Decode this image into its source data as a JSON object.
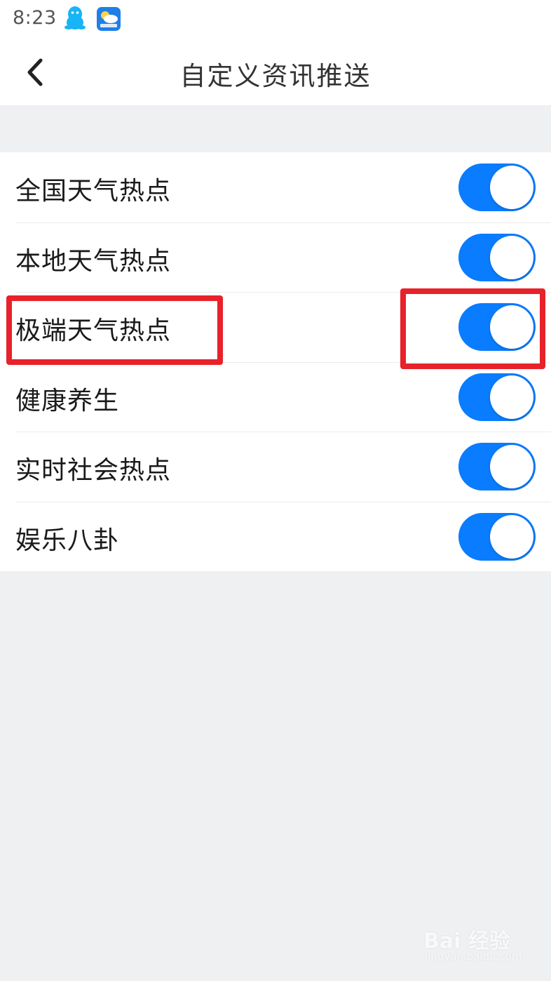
{
  "status_bar": {
    "time": "8:23",
    "icons": [
      "qq-icon",
      "weather-app-icon"
    ]
  },
  "header": {
    "title": "自定义资讯推送",
    "back_icon": "chevron-left-icon"
  },
  "settings": {
    "items": [
      {
        "label": "全国天气热点",
        "enabled": true
      },
      {
        "label": "本地天气热点",
        "enabled": true
      },
      {
        "label": "极端天气热点",
        "enabled": true,
        "highlighted": true
      },
      {
        "label": "健康养生",
        "enabled": true
      },
      {
        "label": "实时社会热点",
        "enabled": true
      },
      {
        "label": "娱乐八卦",
        "enabled": true
      }
    ]
  },
  "colors": {
    "toggle_on": "#0a7cff",
    "highlight": "#e8222b",
    "background": "#eff0f2"
  },
  "watermark": {
    "brand": "Bai 经验",
    "url": "jingyan.baidu.com"
  }
}
